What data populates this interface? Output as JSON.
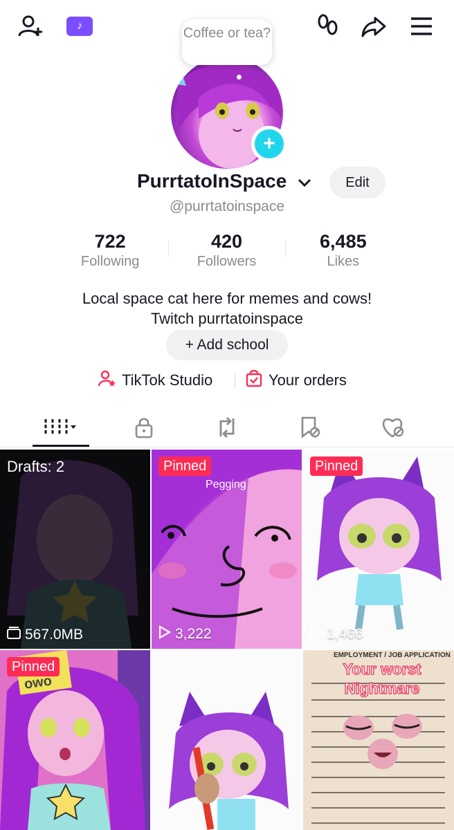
{
  "bubble": {
    "text": "Coffee or tea?"
  },
  "profile": {
    "username": "PurrtatoInSpace",
    "handle": "@purrtatoinspace",
    "edit_label": "Edit",
    "bio_line1": "Local space cat here for memes and cows!",
    "bio_line2": "Twitch purrtatoinspace",
    "add_school": "+ Add school"
  },
  "stats": [
    {
      "num": "722",
      "label": "Following"
    },
    {
      "num": "420",
      "label": "Followers"
    },
    {
      "num": "6,485",
      "label": "Likes"
    }
  ],
  "links": {
    "studio": "TikTok Studio",
    "orders": "Your orders"
  },
  "colors": {
    "accent": "#fe2c55",
    "plus": "#20d5ec",
    "ticket": "#7c4dff"
  },
  "icons": [
    "add-friend-icon",
    "tiktok-ticket-icon",
    "footprints-icon",
    "share-icon",
    "menu-icon",
    "grid-icon",
    "lock-icon",
    "repost-icon",
    "favorites-icon",
    "liked-icon"
  ],
  "grid": {
    "drafts": "Drafts: 2",
    "drafts_size": "567.0MB",
    "pinned": "Pinned",
    "tile2_caption": "Pegging",
    "tile2_views": "3,222",
    "tile3_views": "1,466",
    "tile4_note": "owo",
    "tile6_title": "Your worst Nightmare",
    "tile6_header": "EMPLOYMENT / JOB APPLICATION"
  }
}
